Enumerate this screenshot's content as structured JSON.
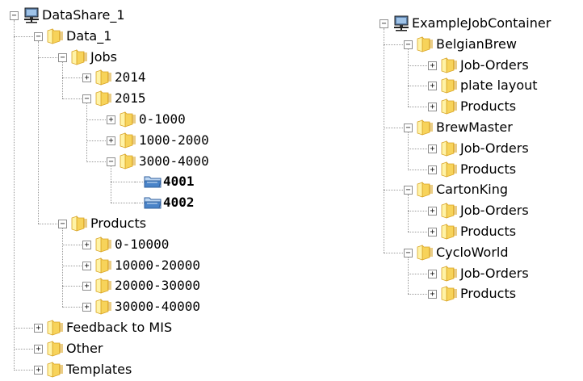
{
  "left_tree": {
    "label": "DataShare_1",
    "icon": "network-drive-icon",
    "expanded": true,
    "children": [
      {
        "label": "Data_1",
        "icon": "folder-icon",
        "expanded": true,
        "children": [
          {
            "label": "Jobs",
            "icon": "folder-icon",
            "expanded": true,
            "children": [
              {
                "label": "2014",
                "icon": "folder-icon",
                "expanded": false,
                "has_children": true
              },
              {
                "label": "2015",
                "icon": "folder-icon",
                "expanded": true,
                "children": [
                  {
                    "label": "0-1000",
                    "icon": "folder-icon",
                    "expanded": false,
                    "has_children": true
                  },
                  {
                    "label": "1000-2000",
                    "icon": "folder-icon",
                    "expanded": false,
                    "has_children": true
                  },
                  {
                    "label": "3000-4000",
                    "icon": "folder-icon",
                    "expanded": true,
                    "children": [
                      {
                        "label": "4001",
                        "icon": "job-folder-icon",
                        "has_children": false
                      },
                      {
                        "label": "4002",
                        "icon": "job-folder-icon",
                        "has_children": false
                      }
                    ]
                  }
                ]
              }
            ]
          },
          {
            "label": "Products",
            "icon": "folder-icon",
            "expanded": true,
            "children": [
              {
                "label": "0-10000",
                "icon": "folder-icon",
                "expanded": false,
                "has_children": true
              },
              {
                "label": "10000-20000",
                "icon": "folder-icon",
                "expanded": false,
                "has_children": true
              },
              {
                "label": "20000-30000",
                "icon": "folder-icon",
                "expanded": false,
                "has_children": true
              },
              {
                "label": "30000-40000",
                "icon": "folder-icon",
                "expanded": false,
                "has_children": true
              }
            ]
          }
        ]
      },
      {
        "label": "Feedback to MIS",
        "icon": "folder-icon",
        "expanded": false,
        "has_children": true
      },
      {
        "label": "Other",
        "icon": "folder-icon",
        "expanded": false,
        "has_children": true
      },
      {
        "label": "Templates",
        "icon": "folder-icon",
        "expanded": false,
        "has_children": true
      }
    ]
  },
  "right_tree": {
    "label": "ExampleJobContainer",
    "icon": "network-drive-icon",
    "expanded": true,
    "children": [
      {
        "label": "BelgianBrew",
        "icon": "folder-icon",
        "expanded": true,
        "children": [
          {
            "label": "Job-Orders",
            "icon": "folder-icon",
            "expanded": false,
            "has_children": true
          },
          {
            "label": "plate layout",
            "icon": "folder-icon",
            "expanded": false,
            "has_children": true
          },
          {
            "label": "Products",
            "icon": "folder-icon",
            "expanded": false,
            "has_children": true
          }
        ]
      },
      {
        "label": "BrewMaster",
        "icon": "folder-icon",
        "expanded": true,
        "children": [
          {
            "label": "Job-Orders",
            "icon": "folder-icon",
            "expanded": false,
            "has_children": true
          },
          {
            "label": "Products",
            "icon": "folder-icon",
            "expanded": false,
            "has_children": true
          }
        ]
      },
      {
        "label": "CartonKing",
        "icon": "folder-icon",
        "expanded": true,
        "children": [
          {
            "label": "Job-Orders",
            "icon": "folder-icon",
            "expanded": false,
            "has_children": true
          },
          {
            "label": "Products",
            "icon": "folder-icon",
            "expanded": false,
            "has_children": true
          }
        ]
      },
      {
        "label": "CycloWorld",
        "icon": "folder-icon",
        "expanded": true,
        "children": [
          {
            "label": "Job-Orders",
            "icon": "folder-icon",
            "expanded": false,
            "has_children": true
          },
          {
            "label": "Products",
            "icon": "folder-icon",
            "expanded": false,
            "has_children": true
          }
        ]
      }
    ]
  },
  "colors": {
    "folder_light": "#fff3a6",
    "folder_mid": "#f7d35a",
    "folder_dark": "#d9a425",
    "job_folder": "#4a84c9",
    "tree_line": "#9a9a9a",
    "toggle_border": "#8e8e8e"
  }
}
